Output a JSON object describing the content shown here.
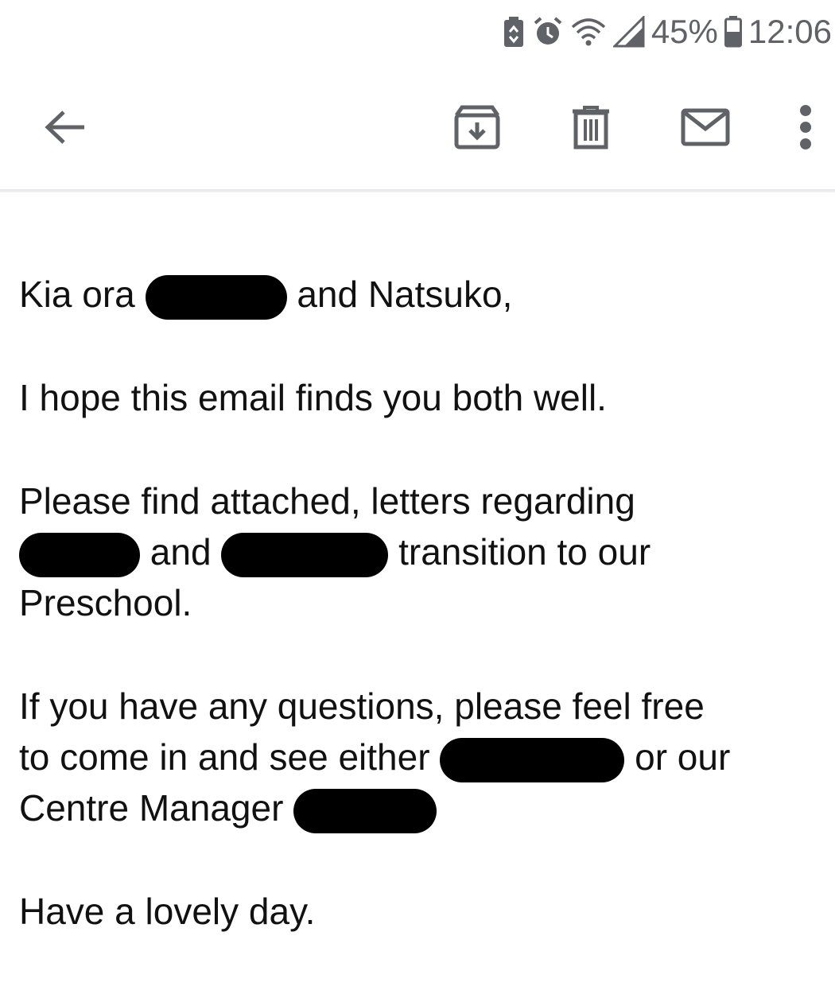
{
  "status_bar": {
    "battery_percent": "45%",
    "time": "12:06",
    "icons": [
      "battery-saver-icon",
      "alarm-icon",
      "wifi-icon",
      "cell-signal-icon",
      "battery-icon"
    ]
  },
  "toolbar": {
    "icons": [
      "back-arrow-icon",
      "archive-icon",
      "delete-icon",
      "mark-unread-icon",
      "more-vert-icon"
    ]
  },
  "email": {
    "greeting_start": "Kia ora",
    "greeting_end": "and Natsuko,",
    "line_hope": "I hope this email finds you both well.",
    "para2_a": "Please find attached, letters regarding",
    "para2_b": "and",
    "para2_c": "transition to our",
    "para2_d": "Preschool.",
    "para3_a": "If you have any questions, please feel free",
    "para3_b": "to come in and see either",
    "para3_c": "or our",
    "para3_d": "Centre Manager",
    "closing": "Have a lovely day."
  },
  "colors": {
    "icon": "#5f6368",
    "text": "#111111",
    "redaction": "#000000"
  }
}
